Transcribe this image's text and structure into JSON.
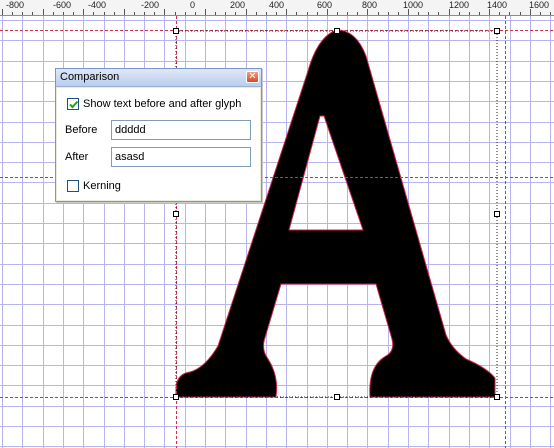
{
  "ruler": {
    "ticks": [
      "-800",
      "-600",
      "-400",
      "-200",
      "0",
      "200",
      "400",
      "600",
      "800",
      "1000",
      "1200",
      "1400",
      "1600"
    ]
  },
  "canvas": {
    "glyph": "A",
    "colors": {
      "grid": "#b8b4f0",
      "guide": "#d03050",
      "glyph_fill": "#000000",
      "glyph_outline": "#cc2244",
      "handle": "#000000"
    }
  },
  "comparison": {
    "title": "Comparison",
    "close_icon": "close-icon",
    "show_text": {
      "label": "Show text before and after glyph",
      "checked": true
    },
    "before": {
      "label": "Before",
      "value": "ddddd"
    },
    "after": {
      "label": "After",
      "value": "asasd"
    },
    "kerning": {
      "label": "Kerning",
      "checked": false
    }
  }
}
